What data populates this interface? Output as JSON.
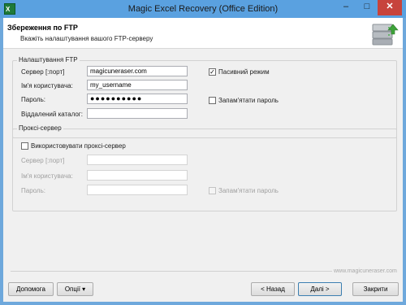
{
  "window": {
    "app_icon_text": "X",
    "title": "Magic Excel Recovery (Office Edition)",
    "controls": {
      "minimize": "–",
      "maximize": "□",
      "close": "✕"
    }
  },
  "header": {
    "title": "Збереження по FTP",
    "subtitle": "Вкажіть налаштування вашого FTP-серверу",
    "icon": "ftp-server-upload-icon"
  },
  "ftp": {
    "title": "Налаштування FTP",
    "server_label": "Сервер [:порт]",
    "server_value": "magicuneraser.com",
    "username_label": "Ім'я користувача:",
    "username_value": "my_username",
    "password_label": "Пароль:",
    "password_value": "●●●●●●●●●●",
    "remote_dir_label": "Віддалений каталог:",
    "remote_dir_value": "",
    "passive_label": "Пасивний режим",
    "passive_checked": true,
    "remember_label": "Запам'ятати пароль",
    "remember_checked": false
  },
  "proxy": {
    "title": "Проксі-сервер",
    "use_label": "Використовувати проксі-сервер",
    "use_checked": false,
    "server_label": "Сервер [:порт]",
    "username_label": "Ім'я користувача:",
    "password_label": "Пароль:",
    "remember_label": "Запам'ятати пароль"
  },
  "footer": {
    "website": "www.magicuneraser.com",
    "help": "Допомога",
    "options": "Опції ▾",
    "back": "< Назад",
    "next": "Далі >",
    "close": "Закрити"
  },
  "colors": {
    "titlebar": "#5aa1e0",
    "close_button": "#c7443c",
    "background": "#f0f0f0"
  }
}
